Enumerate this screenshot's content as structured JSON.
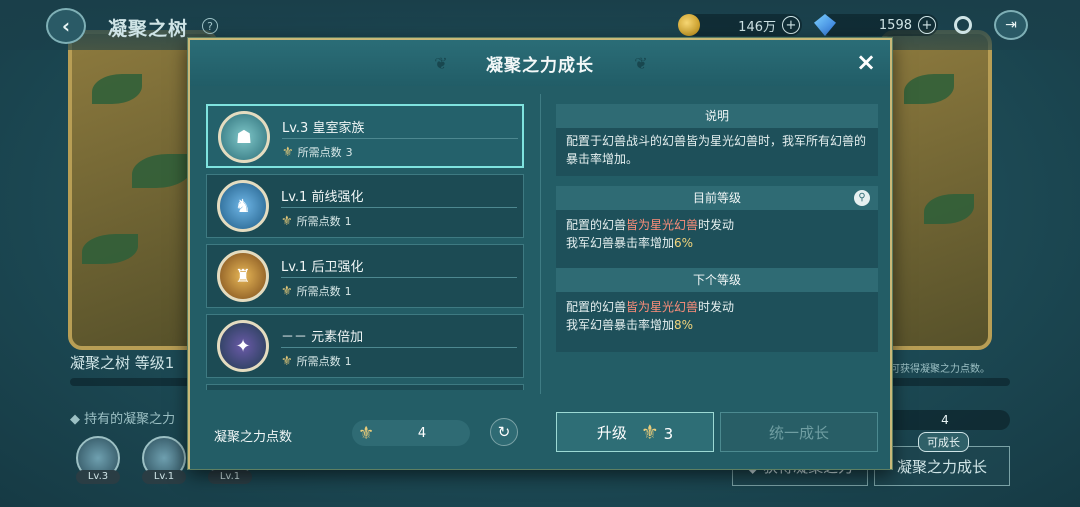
{
  "background": {
    "title": "凝聚之树",
    "help_icon": "?",
    "coins": "146万",
    "gems": "1598",
    "section_label": "凝聚之树  等级1",
    "note": "并可获得凝聚之力点数。",
    "owned_label": "◆ 持有的凝聚之力",
    "owned_levels": [
      "Lv.3",
      "Lv.1",
      "Lv.1"
    ],
    "point_count": "4",
    "badge": "可成长",
    "buttons": [
      "◆ 获得凝聚之力",
      "凝聚之力成长"
    ]
  },
  "modal": {
    "title": "凝聚之力成长",
    "close_icon": "×",
    "skills": [
      {
        "name": "Lv.3  皇室家族",
        "cost_label": "所需点数",
        "cost": "3",
        "selected": true
      },
      {
        "name": "Lv.1  前线强化",
        "cost_label": "所需点数",
        "cost": "1",
        "selected": false
      },
      {
        "name": "Lv.1  后卫强化",
        "cost_label": "所需点数",
        "cost": "1",
        "selected": false
      },
      {
        "name": "－－  元素倍加",
        "cost_label": "所需点数",
        "cost": "1",
        "selected": false
      }
    ],
    "desc_title": "说明",
    "desc_text": "配置于幻兽战斗的幻兽皆为星光幻兽时，我军所有幻兽的暴击率增加。",
    "current_title": "目前等级",
    "current_line1_a": "配置的幻兽",
    "current_line1_b": "皆为星光幻兽",
    "current_line1_c": "时发动",
    "current_line2_a": "我军幻兽暴击率增加",
    "current_line2_b": "6%",
    "next_title": "下个等级",
    "next_line1_a": "配置的幻兽",
    "next_line1_b": "皆为星光幻兽",
    "next_line1_c": "时发动",
    "next_line2_a": "我军幻兽暴击率增加",
    "next_line2_b": "8%",
    "points_label": "凝聚之力点数",
    "points_value": "4",
    "upgrade_label": "升级",
    "upgrade_cost": "3",
    "unify_label": "统一成长"
  },
  "colors": {
    "accent_gold": "#c9b978",
    "highlight_red": "#ff8e7a",
    "highlight_yellow": "#f2d47c"
  },
  "icons": [
    "back-arrow-icon",
    "help-icon",
    "coin-icon",
    "gem-icon",
    "settings-icon",
    "exit-icon",
    "close-icon",
    "fleur-icon",
    "search-icon",
    "refresh-icon"
  ]
}
